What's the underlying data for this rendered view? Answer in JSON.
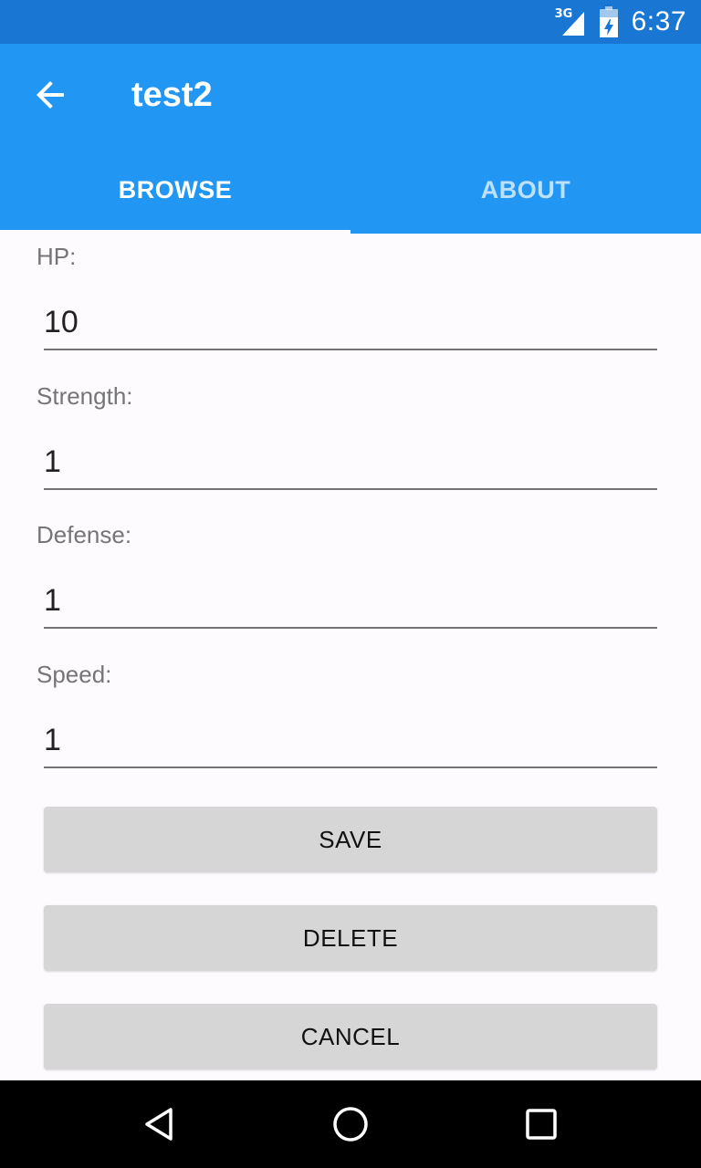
{
  "status_bar": {
    "network": "3G",
    "time": "6:37"
  },
  "app_bar": {
    "title": "test2",
    "back_icon": "arrow-left-icon"
  },
  "tabs": [
    {
      "label": "BROWSE",
      "active": true
    },
    {
      "label": "ABOUT",
      "active": false
    }
  ],
  "form": {
    "hp": {
      "label": "HP:",
      "value": "10"
    },
    "strength": {
      "label": "Strength:",
      "value": "1"
    },
    "defense": {
      "label": "Defense:",
      "value": "1"
    },
    "speed": {
      "label": "Speed:",
      "value": "1"
    }
  },
  "buttons": {
    "save": "SAVE",
    "delete": "DELETE",
    "cancel": "CANCEL"
  },
  "nav": {
    "back_icon": "triangle-back-icon",
    "home_icon": "circle-home-icon",
    "recents_icon": "square-recents-icon"
  },
  "colors": {
    "status_bar": "#1976d2",
    "primary": "#2196f3",
    "button": "#d6d6d6",
    "background": "#fdfbfe"
  }
}
